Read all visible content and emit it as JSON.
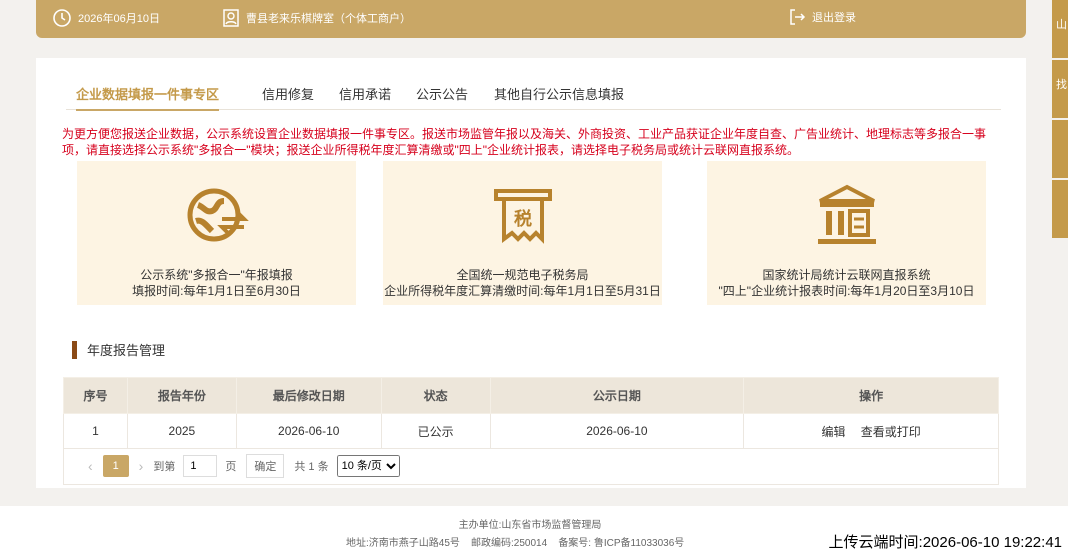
{
  "topbar": {
    "date": "2026年06月10日",
    "company": "曹县老来乐棋牌室（个体工商户）",
    "logout": "退出登录"
  },
  "sidetabs": [
    "山",
    "找",
    "",
    ""
  ],
  "tabs": [
    "企业数据填报一件事专区",
    "信用修复",
    "信用承诺",
    "公示公告",
    "其他自行公示信息填报"
  ],
  "notice": "为更方便您报送企业数据，公示系统设置企业数据填报一件事专区。报送市场监管年报以及海关、外商投资、工业产品获证企业年度自查、广告业统计、地理标志等多报合一事项，请直接选择公示系统\"多报合一\"模块；报送企业所得税年度汇算清缴或\"四上\"企业统计报表，请选择电子税务局或统计云联网直报系统。",
  "services": [
    {
      "icon": "globe-exchange-icon",
      "line1": "公示系统\"多报合一\"年报填报",
      "line2": "填报时间:每年1月1日至6月30日"
    },
    {
      "icon": "tax-ticket-icon",
      "line1": "全国统一规范电子税务局",
      "line2": "企业所得税年度汇算清缴时间:每年1月1日至5月31日"
    },
    {
      "icon": "government-building-icon",
      "line1": "国家统计局统计云联网直报系统",
      "line2": "\"四上\"企业统计报表时间:每年1月20日至3月10日"
    }
  ],
  "section_title": "年度报告管理",
  "table": {
    "headers": [
      "序号",
      "报告年份",
      "最后修改日期",
      "状态",
      "公示日期",
      "操作"
    ],
    "rows": [
      {
        "index": "1",
        "year": "2025",
        "modified": "2026-06-10",
        "status": "已公示",
        "published": "2026-06-10",
        "edit": "编辑",
        "view": "查看或打印"
      }
    ]
  },
  "pager": {
    "current": "1",
    "goto_label": "到第",
    "goto_value": "1",
    "page_label": "页",
    "confirm": "确定",
    "total": "共 1 条",
    "page_size": "10 条/页"
  },
  "footer": {
    "host": "主办单位:山东省市场监督管理局",
    "address": "地址:济南市燕子山路45号",
    "postcode": "邮政编码:250014",
    "icp": "备案号: 鲁ICP备11033036号",
    "upload_time": "上传云端时间:2026-06-10 19:22:41"
  },
  "colors": {
    "accent": "#c9a766",
    "notice": "#d6001c",
    "card_bg": "#fdf4e3"
  }
}
